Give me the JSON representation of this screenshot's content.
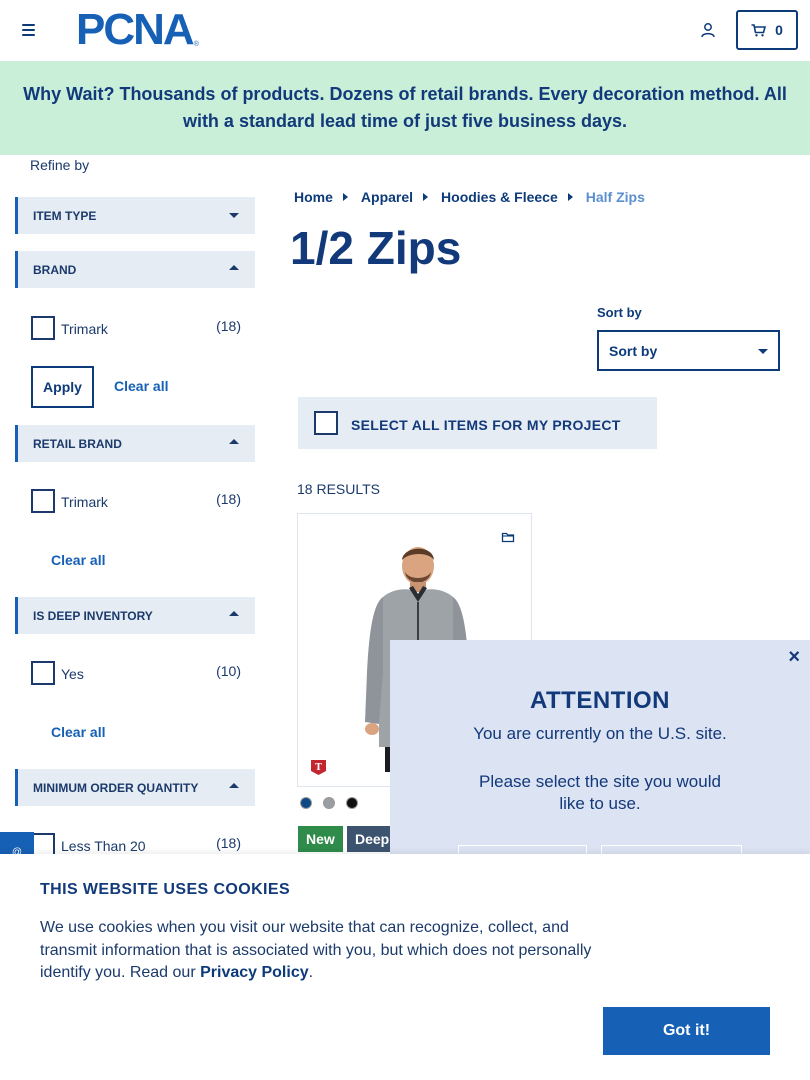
{
  "header": {
    "logo_text": "PCNA",
    "cart_count": "0"
  },
  "banner": {
    "text": "Why Wait? Thousands of products. Dozens of retail brands. Every decoration method. All with a standard lead time of just five business days."
  },
  "sidebar": {
    "refine_label": "Refine by",
    "facets": [
      {
        "label": "ITEM TYPE",
        "state": "collapsed"
      },
      {
        "label": "BRAND",
        "state": "expanded",
        "options": [
          {
            "label": "Trimark",
            "count": "(18)"
          }
        ],
        "apply_label": "Apply",
        "clear_label": "Clear all"
      },
      {
        "label": "RETAIL BRAND",
        "state": "expanded",
        "options": [
          {
            "label": "Trimark",
            "count": "(18)"
          }
        ],
        "clear_label": "Clear all"
      },
      {
        "label": "IS DEEP INVENTORY",
        "state": "expanded",
        "options": [
          {
            "label": "Yes",
            "count": "(10)"
          }
        ],
        "clear_label": "Clear all"
      },
      {
        "label": "MINIMUM ORDER QUANTITY",
        "state": "expanded",
        "options": [
          {
            "label": "Less Than 20",
            "count": "(18)"
          }
        ]
      }
    ]
  },
  "breadcrumb": [
    "Home",
    "Apparel",
    "Hoodies & Fleece",
    "Half Zips"
  ],
  "page_title": "1/2 Zips",
  "sort": {
    "label": "Sort by",
    "value": "Sort by"
  },
  "select_all_label": "SELECT ALL ITEMS FOR MY PROJECT",
  "results_text": "18 RESULTS",
  "product": {
    "swatch_colors": [
      "#0d4a85",
      "#9a9ea3",
      "#111111"
    ],
    "badges": [
      {
        "label": "New",
        "color": "#2e8b4a"
      },
      {
        "label": "Deep",
        "color": "#3d5470"
      }
    ]
  },
  "modal": {
    "close_label": "×",
    "title": "ATTENTION",
    "line1": "You are currently on the U.S. site.",
    "line2": "Please select the site you would like to use."
  },
  "feedback_tab": "@",
  "cookie": {
    "title": "THIS WEBSITE USES COOKIES",
    "text": "We use cookies when you visit our website that can recognize, collect, and transmit information that is associated with you, but which does not personally identify you. Read our ",
    "link": "Privacy Policy",
    "period": ".",
    "button": "Got it!"
  },
  "colors": {
    "brand_blue": "#1660b5",
    "navy": "#0d3b7a",
    "banner_green": "#c9efd9",
    "modal_bg": "#dce3f3"
  }
}
